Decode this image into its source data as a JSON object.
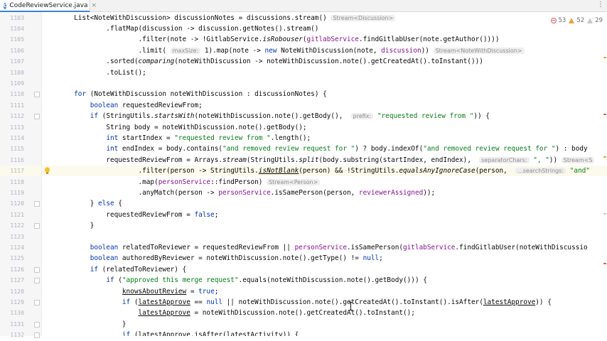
{
  "tab": {
    "icon_letter": "C",
    "filename": "CodeReviewService.java",
    "close": "×"
  },
  "more_tabs": "⋮",
  "inspections": {
    "errors": "53",
    "warnings": "52",
    "weak_warnings": "29"
  },
  "current_line": "1117",
  "lines": [
    {
      "num": "1103",
      "fold": false,
      "html": "        List&lt;NoteWithDiscussion&gt; discussionNotes = discussions.stream() <span class=\"hint\">Stream&lt;Discussion&gt;</span>"
    },
    {
      "num": "1104",
      "fold": false,
      "html": "                .flatMap(discussion -&gt; discussion.getNotes().stream()"
    },
    {
      "num": "1105",
      "fold": false,
      "html": "                        .filter(note -&gt; !GitlabService.<span class=\"sm\">isRobouser</span>(<span class=\"fld\">gitlabService</span>.findGitlabUser(note.getAuthor())))"
    },
    {
      "num": "1106",
      "fold": false,
      "html": "                        .limit( <span class=\"hint\">maxSize:</span> 1).map(note -&gt; <span class=\"kw\">new</span> NoteWithDiscussion(note, <span class=\"fld\">discussion</span>)) <span class=\"hint\">Stream&lt;NoteWithDiscussion&gt;</span>"
    },
    {
      "num": "1107",
      "fold": false,
      "html": "                .sorted(<span class=\"sm\">comparing</span>(noteWithDiscussion -&gt; noteWithDiscussion.note().getCreatedAt().toInstant()))"
    },
    {
      "num": "1108",
      "fold": false,
      "html": "                .toList();"
    },
    {
      "num": "1109",
      "fold": false,
      "html": ""
    },
    {
      "num": "1110",
      "fold": true,
      "html": "        <span class=\"kw\">for</span> (NoteWithDiscussion noteWithDiscussion : discussionNotes) {"
    },
    {
      "num": "1111",
      "fold": false,
      "html": "            <span class=\"kw\">boolean</span> requestedReviewFrom;"
    },
    {
      "num": "1112",
      "fold": true,
      "html": "            <span class=\"kw\">if</span> (StringUtils.<span class=\"sm\">startsWith</span>(noteWithDiscussion.note().getBody(),  <span class=\"hint\">prefix:</span> <span class=\"str\">\"requested review from \"</span>)) {"
    },
    {
      "num": "1113",
      "fold": false,
      "html": "                String body = noteWithDiscussion.note().getBody();"
    },
    {
      "num": "1114",
      "fold": false,
      "html": "                <span class=\"kw\">int</span> startIndex = <span class=\"str\">\"requested review from \"</span>.length();"
    },
    {
      "num": "1115",
      "fold": false,
      "html": "                <span class=\"kw\">int</span> endIndex = body.contains(<span class=\"str\">\"and removed review request for \"</span>) ? body.indexOf(<span class=\"str\">\"and removed review request for \"</span>) : body"
    },
    {
      "num": "1116",
      "fold": false,
      "html": "                requestedReviewFrom = Arrays.<span class=\"sm\">stream</span>(StringUtils.<span class=\"sm\">split</span>(body.substring(startIndex, endIndex),  <span class=\"hint\">separatorChars:</span> <span class=\"str\">\", \"</span>)) <span class=\"hint\">Stream&lt;S</span>"
    },
    {
      "num": "1117",
      "fold": false,
      "html": "                        .filter(person -&gt; StringUtils.<span class=\"sm und\">isNotBlank</span>(person) &amp;&amp; !StringUtils.<span class=\"sm\">equalsAnyIgnoreCase</span>(person,  <span class=\"hint\">...searchStrings:</span> <span class=\"str\">\"and\"</span>"
    },
    {
      "num": "1118",
      "fold": false,
      "html": "                        .map(<span class=\"fld\">personService</span>::findPerson) <span class=\"hint\">Stream&lt;Person&gt;</span>"
    },
    {
      "num": "1119",
      "fold": false,
      "html": "                        .anyMatch(person -&gt; <span class=\"fld\">personService</span>.isSamePerson(person, <span class=\"fld\">reviewerAssigned</span>));"
    },
    {
      "num": "1120",
      "fold": true,
      "html": "            } <span class=\"kw\">else</span> {"
    },
    {
      "num": "1121",
      "fold": false,
      "html": "                requestedReviewFrom = <span class=\"kw\">false</span>;"
    },
    {
      "num": "1122",
      "fold": true,
      "html": "            }"
    },
    {
      "num": "1123",
      "fold": false,
      "html": ""
    },
    {
      "num": "1124",
      "fold": false,
      "html": "            <span class=\"kw\">boolean</span> relatedToReviewer = requestedReviewFrom || <span class=\"fld\">personService</span>.isSamePerson(<span class=\"fld\">gitlabService</span>.findGitlabUser(noteWithDiscussio"
    },
    {
      "num": "1125",
      "fold": false,
      "html": "            <span class=\"kw\">boolean</span> authoredByReviewer = noteWithDiscussion.note().getType() != <span class=\"kw\">null</span>;"
    },
    {
      "num": "1126",
      "fold": true,
      "html": "            <span class=\"kw\">if</span> (relatedToReviewer) {"
    },
    {
      "num": "1127",
      "fold": true,
      "html": "                <span class=\"kw\">if</span> (<span class=\"str\">\"approved this merge request\"</span>.equals(noteWithDiscussion.note().getBody())) {"
    },
    {
      "num": "1128",
      "fold": false,
      "html": "                    <span class=\"und\">knowsAboutReview</span> = <span class=\"kw\">true</span>;"
    },
    {
      "num": "1129",
      "fold": true,
      "html": "                    <span class=\"kw\">if</span> (<span class=\"und\">latestApprove</span> == <span class=\"kw\">null</span> || noteWithDiscussion.note().getCreatedAt().toInstant().isAfter(<span class=\"und\">latestApprove</span>)) {"
    },
    {
      "num": "1130",
      "fold": false,
      "html": "                        <span class=\"und\">latestApprove</span> = noteWithDiscussion.note().getCreatedAt().toInstant();"
    },
    {
      "num": "1131",
      "fold": true,
      "html": "                    }"
    },
    {
      "num": "1132",
      "fold": true,
      "html": "                    <span class=\"kw\">if</span> (<span class=\"und\">latestApprove</span>.isAfter(<span class=\"und\">latestActivity</span>)) {"
    }
  ]
}
